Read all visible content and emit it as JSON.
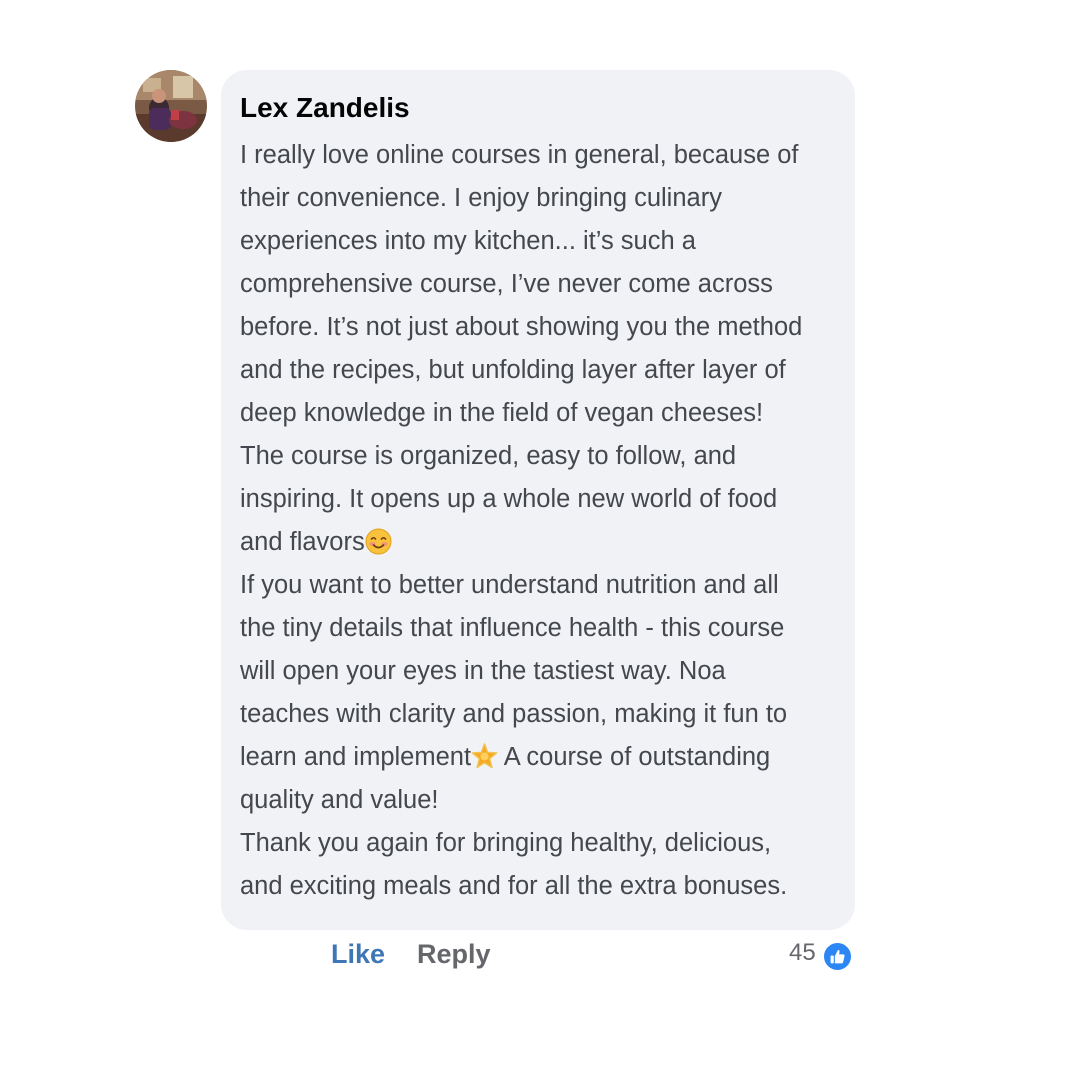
{
  "comment": {
    "author": "Lex Zandelis",
    "avatar_icon": "profile-photo",
    "lines": [
      "I really love online courses in general, because of",
      "their convenience. I enjoy bringing culinary",
      "experiences into my kitchen... it’s such a",
      "comprehensive course, I’ve never come across",
      "before. It’s not just about showing you the method",
      "and the recipes, but unfolding layer after layer of",
      "deep knowledge in the field of vegan cheeses!",
      "The course is organized, easy to follow, and",
      "inspiring. It opens up a whole new world of food",
      "and flavors",
      "If you want to better understand nutrition and all",
      "the tiny details that influence health - this course",
      "will open your eyes in the tastiest way. Noa",
      "teaches with clarity and passion, making it fun to",
      "learn and implement",
      "quality and value!",
      "Thank you again for bringing healthy, delicious,",
      "and exciting meals and for all the extra bonuses."
    ],
    "line_15_continuation": " A course of outstanding",
    "emoji_1": "smiling-face-emoji",
    "emoji_2": "glowing-star-emoji"
  },
  "actions": {
    "like_label": "Like",
    "reply_label": "Reply",
    "reaction_count": "45",
    "reaction_icon": "thumbs-up-icon"
  },
  "colors": {
    "bubble_bg": "#f0f2f5",
    "like_link": "#3f76b5",
    "reply_link": "#65676b",
    "badge": "#2c87f5"
  }
}
